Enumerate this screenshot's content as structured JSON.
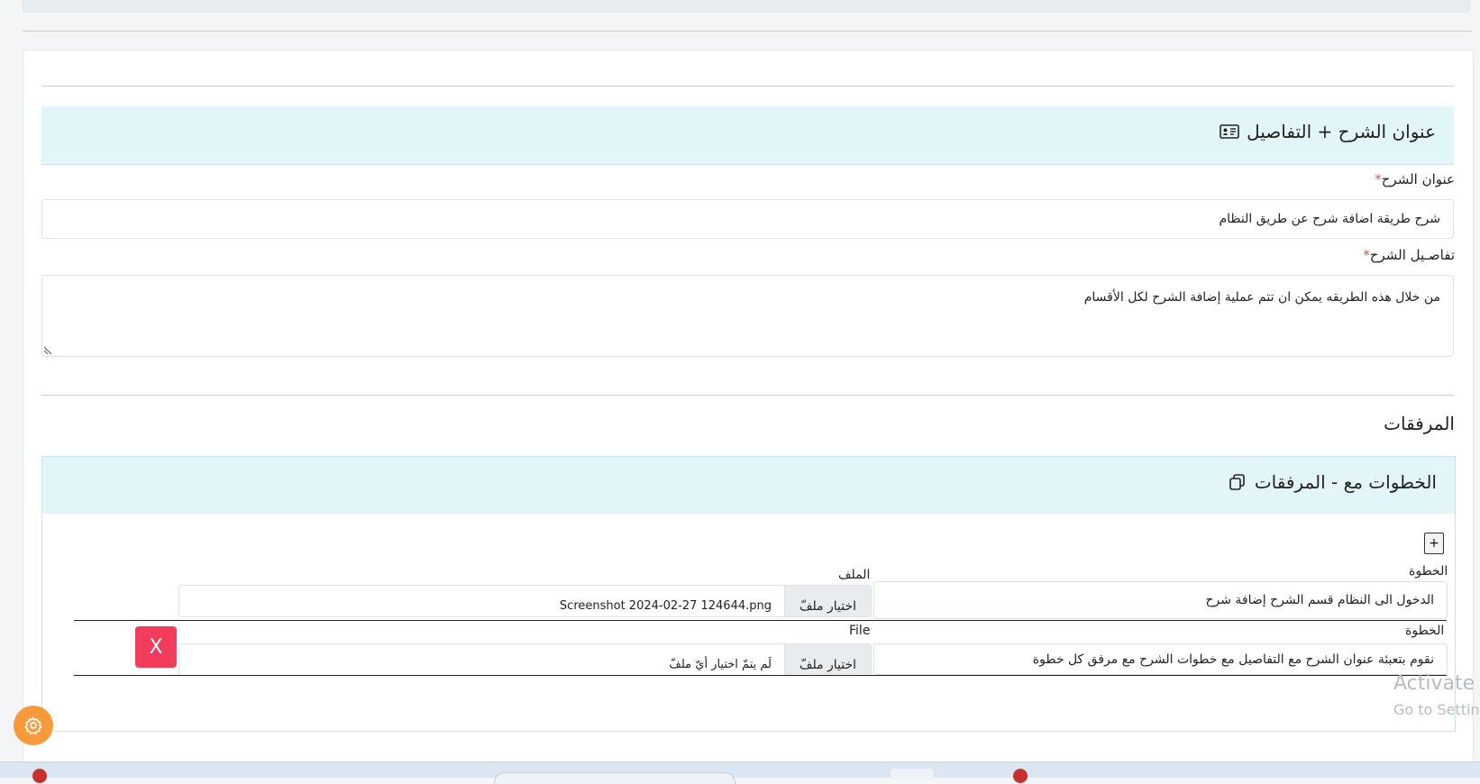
{
  "details_section": {
    "title": "عنوان الشرح + التفاصيل",
    "title_icon": "id-card-icon",
    "title_label": "عنوان الشرح",
    "title_value": "شرح طريقة اضافة شرح عن طريق النظام",
    "details_label": "تفاصـيل الشرح",
    "details_value": "من خلال هذه الطريقه يمكن ان تتم عملية إضافة الشرح لكل الأقسام",
    "required_mark": "*"
  },
  "attachments": {
    "heading": "المرفقات",
    "steps_title": "الخطوات مع - المرفقات",
    "steps_icon": "copy-icon",
    "add_label": "+",
    "steps": [
      {
        "step_label": "الخطوة",
        "step_value": "الدخول الى النظام قسم الشرح إضافة شرح",
        "file_label": "الملف",
        "choose_label": "اختيار ملفّ",
        "file_name": "Screenshot 2024-02-27 124644.png"
      },
      {
        "step_label": "الخطوة",
        "step_value": "نقوم بتعبئة  عنوان الشرح مع التفاصيل مع خطوات الشرح مع مرفق كل خطوة",
        "file_label": "File",
        "choose_label": "اختيار ملفّ",
        "file_name": "لَم يتمّ اختيار أيّ ملفّ",
        "delete_label": "X"
      }
    ]
  },
  "watermark": {
    "line1": "Activate",
    "line2": "Go to Settin"
  },
  "colors": {
    "section_header": "#e2f5f8",
    "delete_button": "#f23c5c",
    "settings_button": "#f89a3b",
    "required": "#d9534f"
  }
}
